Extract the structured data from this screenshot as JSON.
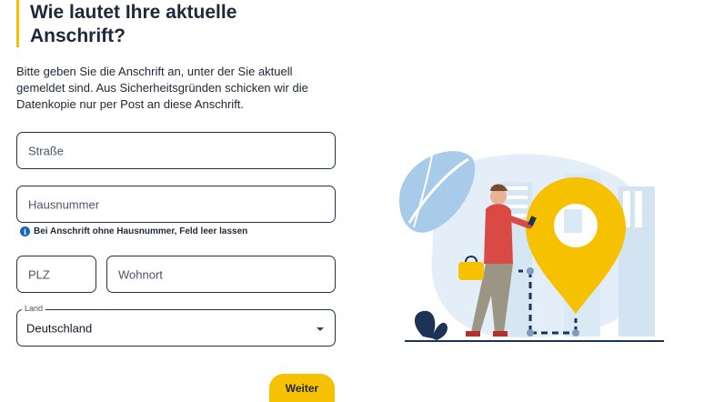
{
  "heading": {
    "line1": "Wie lautet Ihre aktuelle",
    "line2": "Anschrift?"
  },
  "intro": "Bitte geben Sie die Anschrift an, unter der Sie aktuell gemeldet sind. Aus Sicherheitsgründen schicken wir die Datenkopie nur per Post an diese Anschrift.",
  "form": {
    "street_placeholder": "Straße",
    "house_number_placeholder": "Hausnummer",
    "house_number_hint": "Bei Anschrift ohne Hausnummer, Feld leer lassen",
    "zip_placeholder": "PLZ",
    "city_placeholder": "Wohnort",
    "country_label": "Land",
    "country_value": "Deutschland"
  },
  "actions": {
    "next_label": "Weiter"
  },
  "colors": {
    "accent": "#f6c100",
    "field_border": "#1d3355",
    "info": "#1565c0"
  },
  "icons": {
    "hint": "info-icon",
    "select": "chevron-down-icon"
  }
}
